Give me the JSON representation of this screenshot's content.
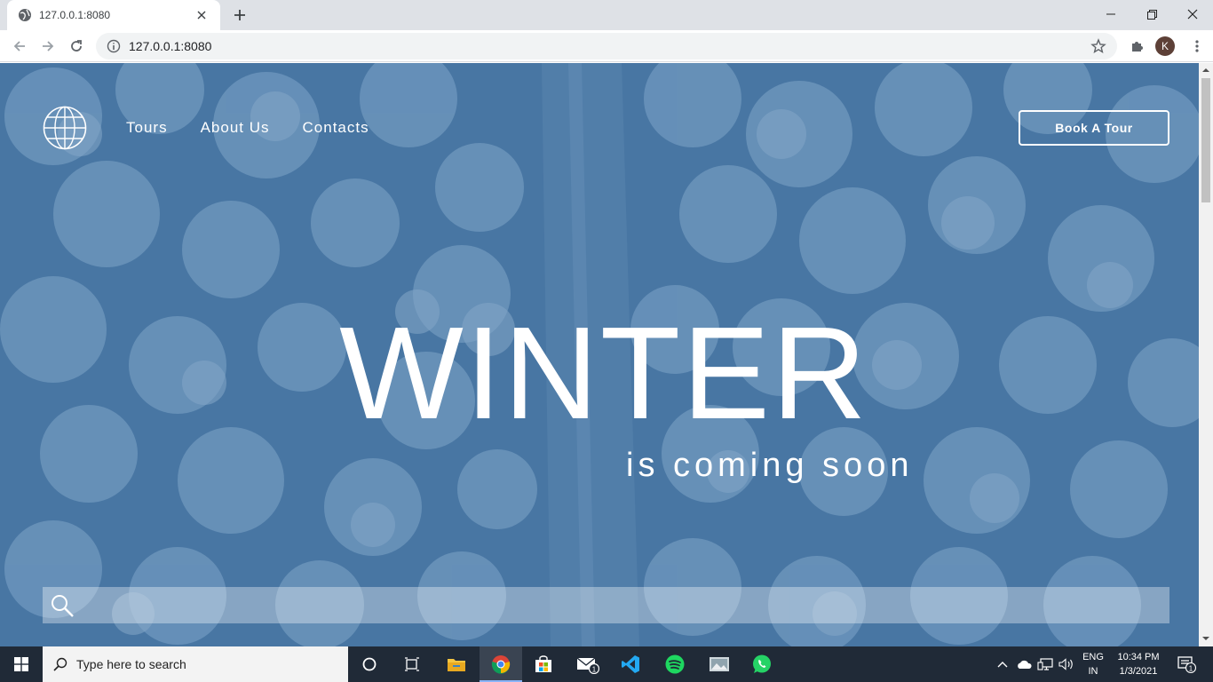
{
  "browser": {
    "tab_title": "127.0.0.1:8080",
    "url": "127.0.0.1:8080",
    "profile_initial": "K"
  },
  "page": {
    "nav": [
      "Tours",
      "About Us",
      "Contacts"
    ],
    "book_button": "Book A Tour",
    "headline": "WINTER",
    "subheadline": "is coming soon",
    "search_placeholder": "",
    "colors": {
      "hero_tint": "#4e7aa6",
      "text": "#ffffff"
    }
  },
  "taskbar": {
    "search_placeholder": "Type here to search",
    "lang_top": "ENG",
    "lang_bottom": "IN",
    "time": "10:34 PM",
    "date": "1/3/2021",
    "mail_badge": "1",
    "notifications_badge": "1"
  }
}
